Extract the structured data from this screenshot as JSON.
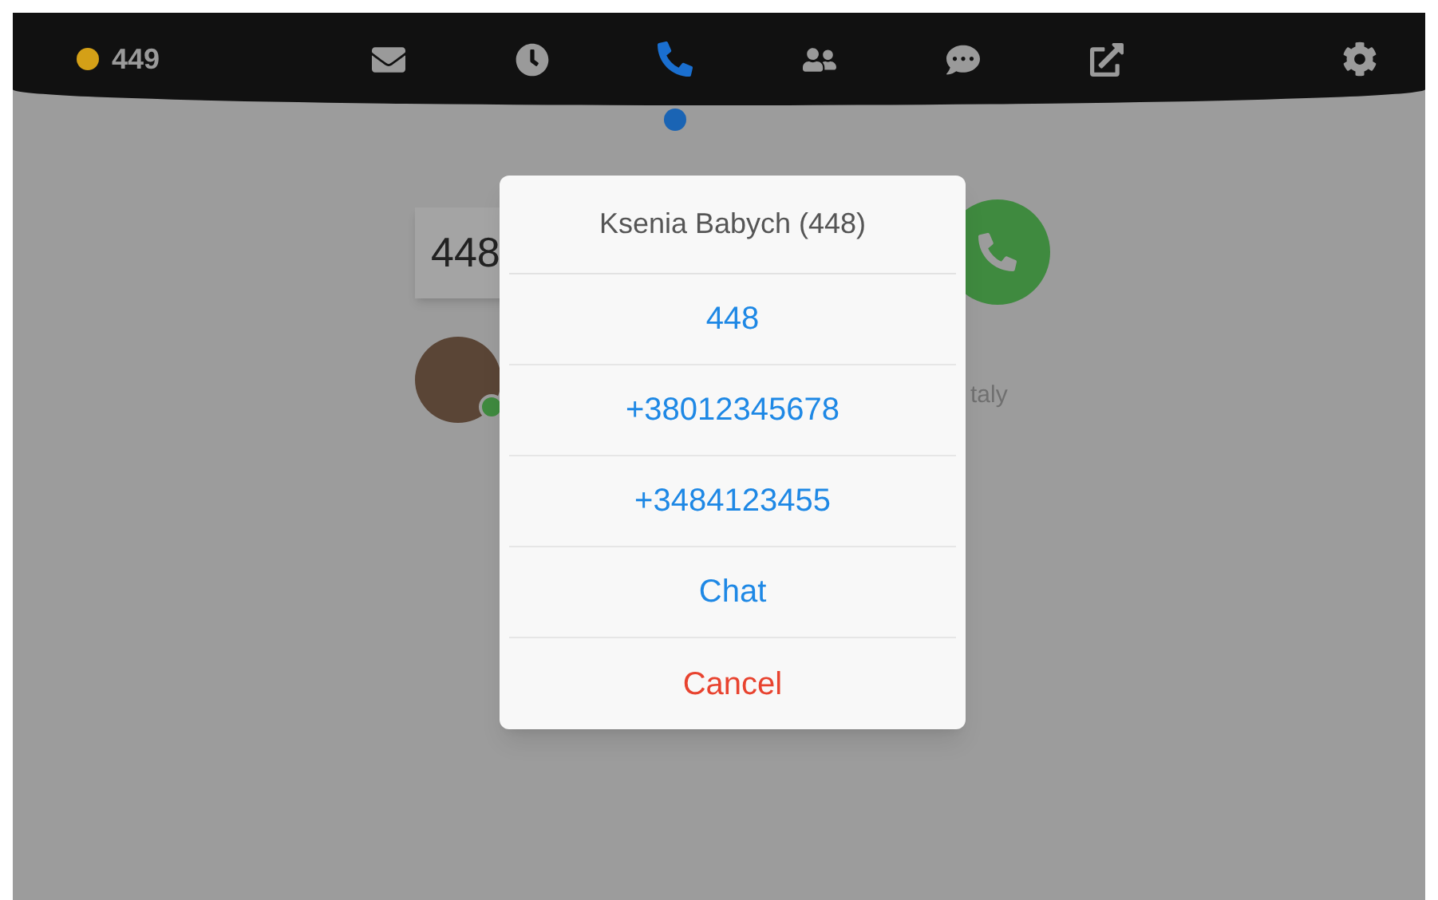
{
  "status": {
    "label": "449",
    "color": "#d4a017"
  },
  "nav": [
    {
      "kind": "mail",
      "selected": false
    },
    {
      "kind": "history",
      "selected": false
    },
    {
      "kind": "phone",
      "selected": true
    },
    {
      "kind": "contacts",
      "selected": false
    },
    {
      "kind": "chat",
      "selected": false
    },
    {
      "kind": "external",
      "selected": false
    }
  ],
  "dialer": {
    "value": "448",
    "contact_detail": "taly",
    "online": true
  },
  "dialog": {
    "title": "Ksenia Babych (448)",
    "options": [
      {
        "label": "448",
        "kind": "action"
      },
      {
        "label": "+38012345678",
        "kind": "action"
      },
      {
        "label": "+3484123455",
        "kind": "action"
      },
      {
        "label": "Chat",
        "kind": "action"
      },
      {
        "label": "Cancel",
        "kind": "cancel"
      }
    ]
  }
}
